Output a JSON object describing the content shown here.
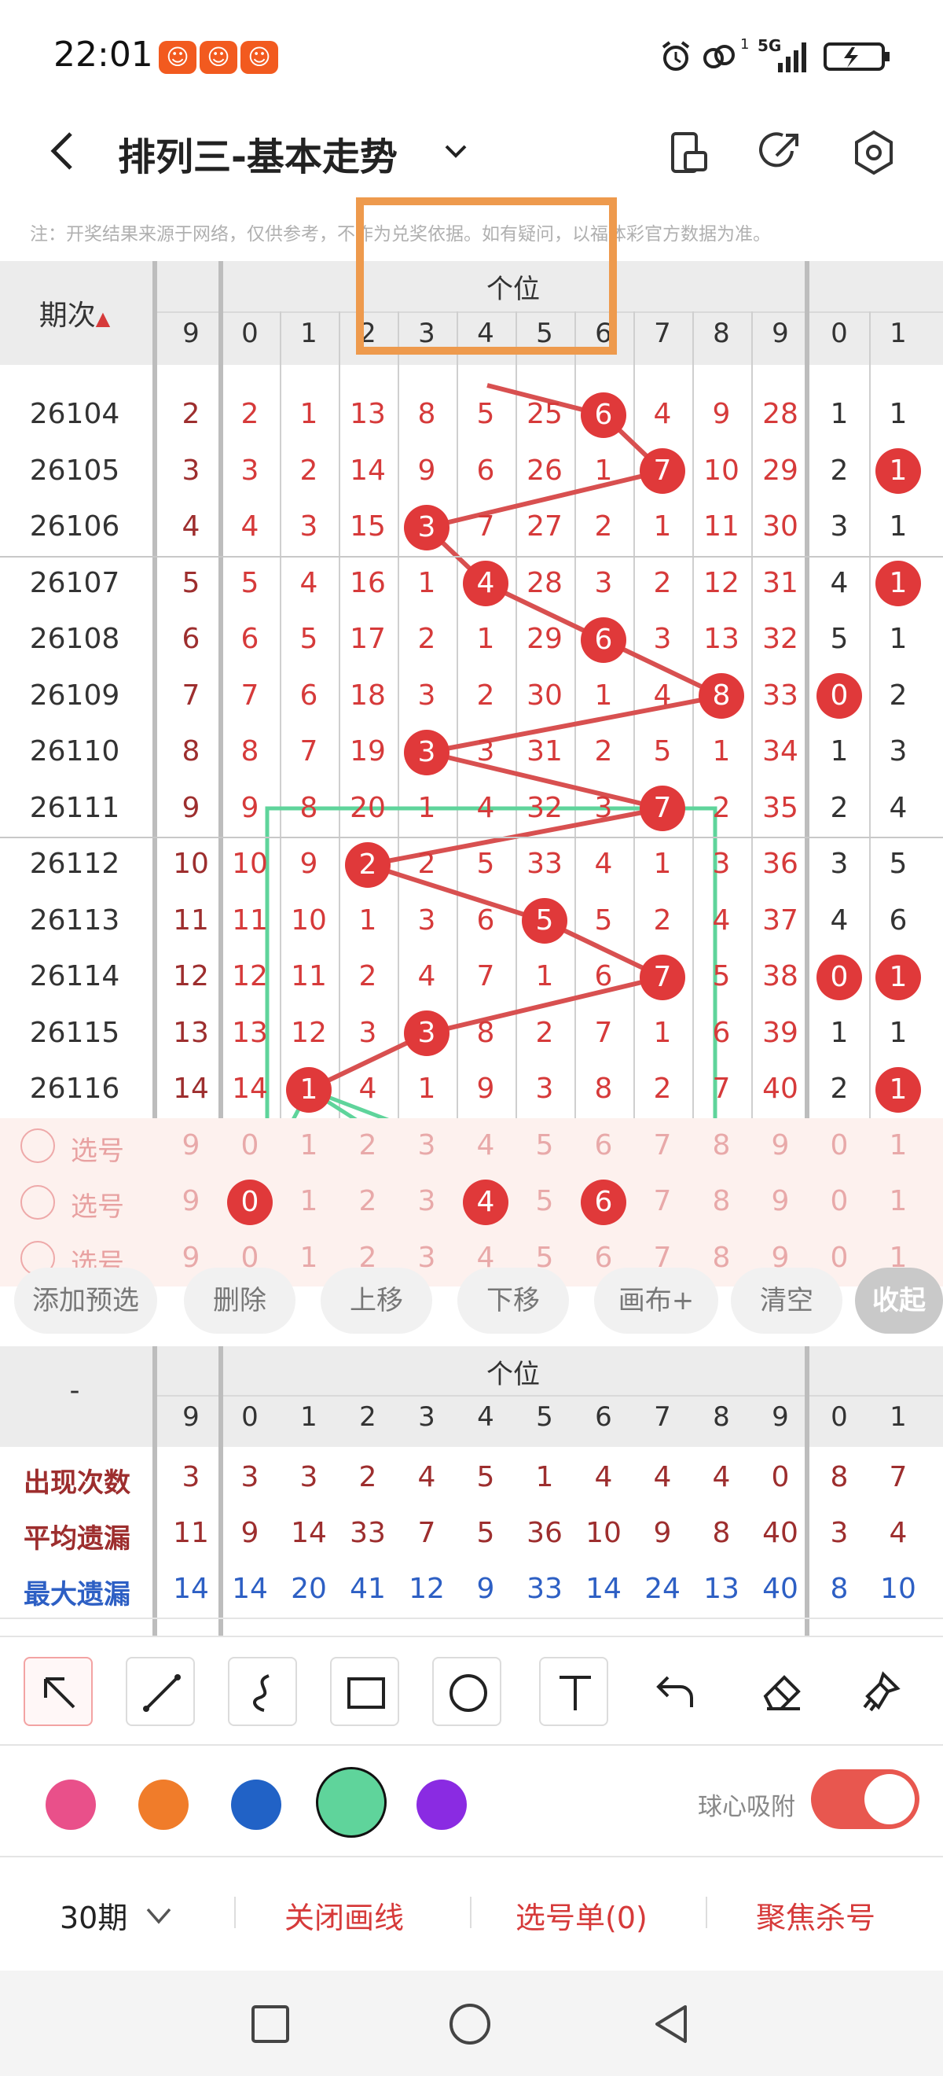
{
  "status_bar": {
    "time": "22:01",
    "network": "5G",
    "sim": "1"
  },
  "header": {
    "title": "排列三-基本走势"
  },
  "notice": "注：开奖结果来源于网络，仅供参考，不作为兑奖依据。如有疑问，以福体彩官方数据为准。",
  "table": {
    "period_header": "期次",
    "group_header": "个位",
    "col_headers": [
      "9",
      "0",
      "1",
      "2",
      "3",
      "4",
      "5",
      "6",
      "7",
      "8",
      "9",
      "0",
      "1"
    ],
    "rows": [
      {
        "period": "26104",
        "cells": [
          "2",
          "2",
          "1",
          "13",
          "8",
          "5",
          "25",
          "6",
          "4",
          "9",
          "28",
          "1",
          "1"
        ]
      },
      {
        "period": "26105",
        "cells": [
          "3",
          "3",
          "2",
          "14",
          "9",
          "6",
          "26",
          "1",
          "7",
          "10",
          "29",
          "2",
          "1"
        ]
      },
      {
        "period": "26106",
        "cells": [
          "4",
          "4",
          "3",
          "15",
          "3",
          "7",
          "27",
          "2",
          "1",
          "11",
          "30",
          "3",
          "1"
        ]
      },
      {
        "period": "26107",
        "cells": [
          "5",
          "5",
          "4",
          "16",
          "1",
          "4",
          "28",
          "3",
          "2",
          "12",
          "31",
          "4",
          "1"
        ]
      },
      {
        "period": "26108",
        "cells": [
          "6",
          "6",
          "5",
          "17",
          "2",
          "1",
          "29",
          "6",
          "3",
          "13",
          "32",
          "5",
          "1"
        ]
      },
      {
        "period": "26109",
        "cells": [
          "7",
          "7",
          "6",
          "18",
          "3",
          "2",
          "30",
          "1",
          "4",
          "8",
          "33",
          "0",
          "2"
        ]
      },
      {
        "period": "26110",
        "cells": [
          "8",
          "8",
          "7",
          "19",
          "3",
          "3",
          "31",
          "2",
          "5",
          "1",
          "34",
          "1",
          "3"
        ]
      },
      {
        "period": "26111",
        "cells": [
          "9",
          "9",
          "8",
          "20",
          "1",
          "4",
          "32",
          "3",
          "7",
          "2",
          "35",
          "2",
          "4"
        ]
      },
      {
        "period": "26112",
        "cells": [
          "10",
          "10",
          "9",
          "2",
          "2",
          "5",
          "33",
          "4",
          "1",
          "3",
          "36",
          "3",
          "5"
        ]
      },
      {
        "period": "26113",
        "cells": [
          "11",
          "11",
          "10",
          "1",
          "3",
          "6",
          "5",
          "5",
          "2",
          "4",
          "37",
          "4",
          "6"
        ]
      },
      {
        "period": "26114",
        "cells": [
          "12",
          "12",
          "11",
          "2",
          "4",
          "7",
          "1",
          "6",
          "7",
          "5",
          "38",
          "0",
          "1"
        ]
      },
      {
        "period": "26115",
        "cells": [
          "13",
          "13",
          "12",
          "3",
          "3",
          "8",
          "2",
          "7",
          "1",
          "6",
          "39",
          "1",
          "1"
        ]
      },
      {
        "period": "26116",
        "cells": [
          "14",
          "14",
          "1",
          "4",
          "1",
          "9",
          "3",
          "8",
          "2",
          "7",
          "40",
          "2",
          "1"
        ]
      }
    ],
    "select_label": "选号",
    "select_digits": [
      "9",
      "0",
      "1",
      "2",
      "3",
      "4",
      "5",
      "6",
      "7",
      "8",
      "9",
      "0",
      "1"
    ]
  },
  "actions": [
    "添加预选",
    "删除",
    "上移",
    "下移",
    "画布+",
    "清空",
    "收起"
  ],
  "stats": {
    "dash": "-",
    "group_header": "个位",
    "col_headers": [
      "9",
      "0",
      "1",
      "2",
      "3",
      "4",
      "5",
      "6",
      "7",
      "8",
      "9",
      "0",
      "1"
    ],
    "rows": [
      {
        "label": "出现次数",
        "values": [
          "3",
          "3",
          "3",
          "2",
          "4",
          "5",
          "1",
          "4",
          "4",
          "4",
          "0",
          "8",
          "7"
        ]
      },
      {
        "label": "平均遗漏",
        "values": [
          "11",
          "9",
          "14",
          "33",
          "7",
          "5",
          "36",
          "10",
          "9",
          "8",
          "40",
          "3",
          "4"
        ]
      },
      {
        "label": "最大遗漏",
        "values": [
          "14",
          "14",
          "20",
          "41",
          "12",
          "9",
          "33",
          "14",
          "24",
          "13",
          "40",
          "8",
          "10"
        ]
      }
    ]
  },
  "tools": [
    "arrow-tool",
    "line-tool",
    "curve-tool",
    "rectangle-tool",
    "circle-tool",
    "text-tool",
    "undo",
    "eraser",
    "clear-brush"
  ],
  "palette": [
    "#e9508a",
    "#f07c2a",
    "#2162c6",
    "#5fd49b",
    "#8a2be2"
  ],
  "palette_selected": "#5fd49b",
  "snap_label": "球心吸附",
  "snap_on": true,
  "bottom_bar": {
    "period": "30期",
    "close_draw": "关闭画线",
    "pick_list": "选号单(0)",
    "focus_kill": "聚焦杀号"
  },
  "colors": {
    "accent": "#e0393a",
    "highlight_box": "#ee9a4d",
    "draw_green": "#5fd49b"
  }
}
